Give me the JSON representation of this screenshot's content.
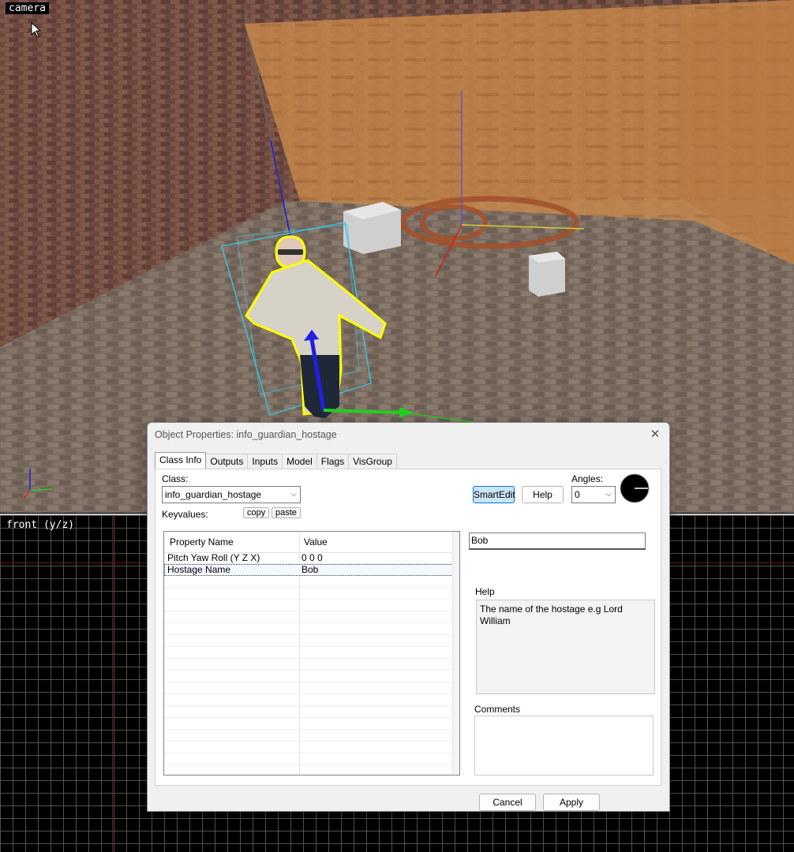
{
  "camera_view": {
    "label": "camera"
  },
  "front_view": {
    "label": "front (y/z)"
  },
  "dialog": {
    "title": "Object Properties: info_guardian_hostage",
    "close_glyph": "✕",
    "tabs": [
      {
        "label": "Class Info",
        "active": true
      },
      {
        "label": "Outputs"
      },
      {
        "label": "Inputs"
      },
      {
        "label": "Model"
      },
      {
        "label": "Flags"
      },
      {
        "label": "VisGroup"
      }
    ],
    "class_label": "Class:",
    "class_value": "info_guardian_hostage",
    "keyvalues_label": "Keyvalues:",
    "copy_label": "copy",
    "paste_label": "paste",
    "smartedit_label": "SmartEdit",
    "help_button_label": "Help",
    "angles_label": "Angles:",
    "angles_value": "0",
    "table": {
      "headers": [
        "Property Name",
        "Value"
      ],
      "rows": [
        {
          "name": "Pitch Yaw Roll (Y Z X)",
          "value": "0 0 0"
        },
        {
          "name": "Hostage Name",
          "value": "Bob",
          "selected": true
        }
      ]
    },
    "value_field": "Bob",
    "help_label": "Help",
    "help_text": "The name of the hostage e.g Lord William",
    "comments_label": "Comments",
    "comments_text": "",
    "cancel_label": "Cancel",
    "apply_label": "Apply"
  },
  "colors": {
    "selection_box": "#33c8e8",
    "outline": "#ffff00",
    "trigger_wall": "#c8874a",
    "axis_x": "#e02020",
    "axis_y": "#20d020",
    "axis_z": "#2020e0"
  },
  "icons": [
    "mouse-cursor-icon",
    "close-icon",
    "chevron-down-icon",
    "angle-dial-icon"
  ]
}
